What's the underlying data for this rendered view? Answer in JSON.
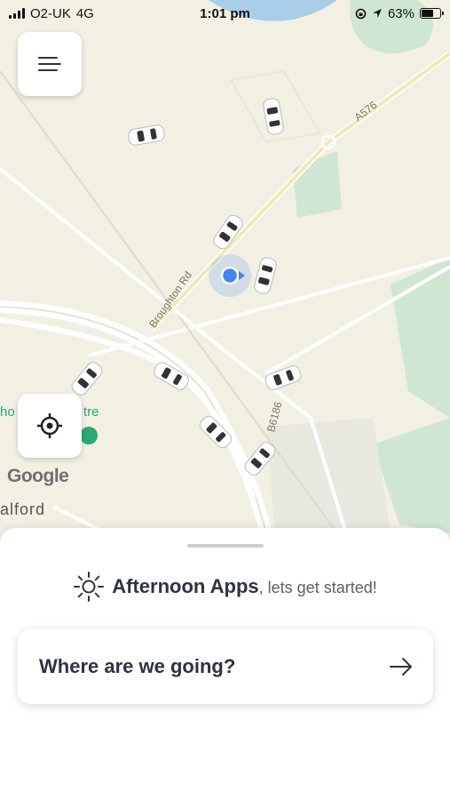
{
  "status_bar": {
    "carrier": "O2-UK",
    "network": "4G",
    "time": "1:01 pm",
    "battery": "63%",
    "battery_level": 0.63
  },
  "map": {
    "road_labels": [
      "A576",
      "Broughton Rd",
      "B6186"
    ],
    "place_label": "ho",
    "place_label_2": "tre",
    "town_label": "alford",
    "attribution": "Google",
    "colors": {
      "land": "#f2efe3",
      "park": "#cfe6d3",
      "water": "#a9cfe8",
      "road": "#ffffff",
      "user_dot": "#4285f4"
    }
  },
  "controls": {
    "menu_icon": "menu-lines-icon",
    "locate_icon": "crosshair-icon"
  },
  "sheet": {
    "brand": "Afternoon Apps",
    "greeting_tail": ", lets get started!",
    "destination_prompt": "Where are we going?",
    "sun_icon": "sun-icon",
    "arrow_icon": "arrow-right-icon"
  }
}
